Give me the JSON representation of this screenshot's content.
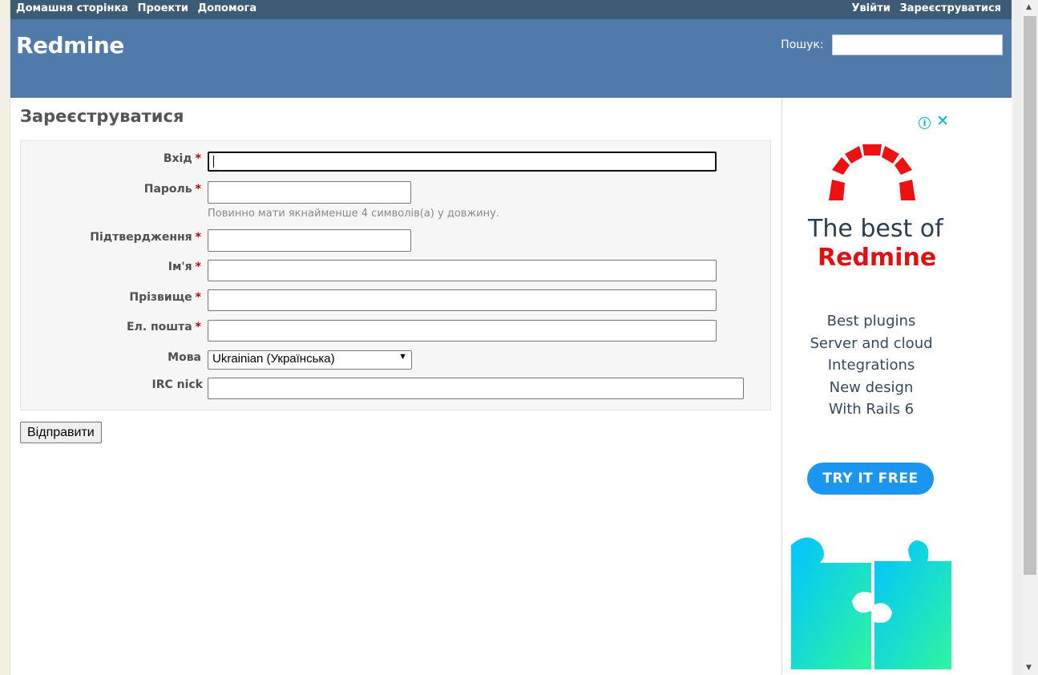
{
  "top_menu": {
    "left": [
      "Домашня сторінка",
      "Проекти",
      "Допомога"
    ],
    "right": [
      "Увійти",
      "Зареєструватися"
    ]
  },
  "header": {
    "title": "Redmine",
    "search_label": "Пошук:",
    "search_value": ""
  },
  "page": {
    "title": "Зареєструватися",
    "fields": {
      "login": {
        "label": "Вхід",
        "value": ""
      },
      "password": {
        "label": "Пароль",
        "value": "",
        "hint": "Повинно мати якнайменше 4 символів(а) у довжину."
      },
      "confirmation": {
        "label": "Підтвердження",
        "value": ""
      },
      "firstname": {
        "label": "Ім'я",
        "value": ""
      },
      "lastname": {
        "label": "Прізвище",
        "value": ""
      },
      "email": {
        "label": "Ел. пошта",
        "value": ""
      },
      "language": {
        "label": "Мова",
        "value": "Ukrainian (Українська)"
      },
      "irc": {
        "label": "IRC nick",
        "value": ""
      }
    },
    "required_mark": "*",
    "submit_label": "Відправити"
  },
  "ad": {
    "title_line1": "The best of",
    "title_line2": "Redmine",
    "items": [
      "Best plugins",
      "Server and cloud",
      "Integrations",
      "New design",
      "With Rails 6"
    ],
    "cta": "TRY IT FREE",
    "colors": {
      "accent": "#1a95f0",
      "red": "#e01010"
    }
  },
  "colors": {
    "top_menu_bg": "#3e5b76",
    "header_bg": "#507aaa"
  }
}
